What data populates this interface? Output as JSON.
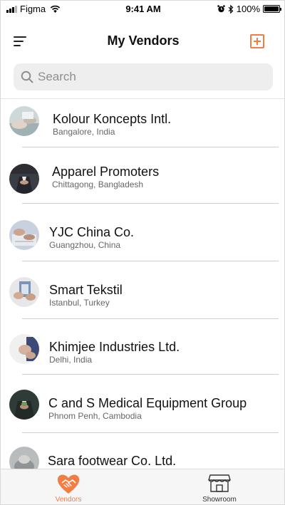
{
  "status_bar": {
    "carrier": "Figma",
    "time": "9:41 AM",
    "battery": "100%",
    "icons": [
      "signal-icon",
      "wifi-icon",
      "alarm-icon",
      "bluetooth-icon",
      "battery-icon"
    ]
  },
  "nav": {
    "title": "My Vendors",
    "menu_icon": "hamburger-icon",
    "add_icon": "add-square-icon"
  },
  "search": {
    "placeholder": "Search",
    "value": ""
  },
  "vendors": [
    {
      "name": "Kolour Koncepts Intl.",
      "location": "Bangalore, India"
    },
    {
      "name": "Apparel Promoters",
      "location": "Chittagong, Bangladesh"
    },
    {
      "name": "YJC China Co.",
      "location": "Guangzhou, China"
    },
    {
      "name": "Smart Tekstil",
      "location": "Istanbul, Turkey"
    },
    {
      "name": "Khimjee Industries Ltd.",
      "location": "Delhi, India"
    },
    {
      "name": "C and S Medical Equipment Group",
      "location": "Phnom Penh, Cambodia"
    },
    {
      "name": "Sara footwear Co. Ltd.",
      "location": ""
    }
  ],
  "tabs": [
    {
      "label": "Vendors",
      "icon": "handshake-heart-icon",
      "active": true
    },
    {
      "label": "Showroom",
      "icon": "storefront-icon",
      "active": false
    }
  ],
  "colors": {
    "accent": "#f27d45",
    "search_bg": "#eeeeef",
    "divider": "#cfcfcf",
    "tab_bar_bg": "#f6f6f6"
  }
}
